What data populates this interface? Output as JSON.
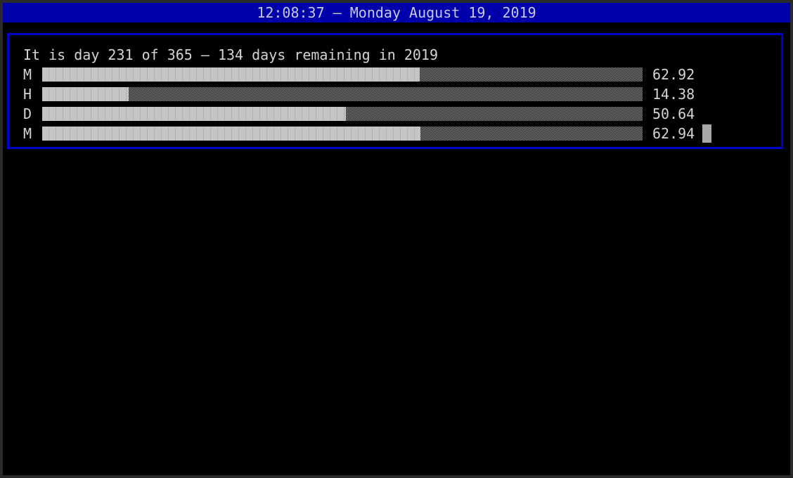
{
  "title_bar": {
    "text": "12:08:37 – Monday August 19, 2019"
  },
  "summary": {
    "text": "It is day 231 of 365 – 134 days remaining in 2019"
  },
  "bars": [
    {
      "label": "M",
      "value_text": "62.92",
      "percent": 62.92
    },
    {
      "label": "H",
      "value_text": "14.38",
      "percent": 14.38
    },
    {
      "label": "D",
      "value_text": "50.64",
      "percent": 50.64
    },
    {
      "label": "M",
      "value_text": "62.94",
      "percent": 62.94
    }
  ],
  "colors": {
    "title_bar_background": "#0000aa",
    "panel_border": "#0000cc",
    "text": "#d4d4d4",
    "bar_fill": "#c4c4c4"
  },
  "cursor": {
    "visible": true
  }
}
